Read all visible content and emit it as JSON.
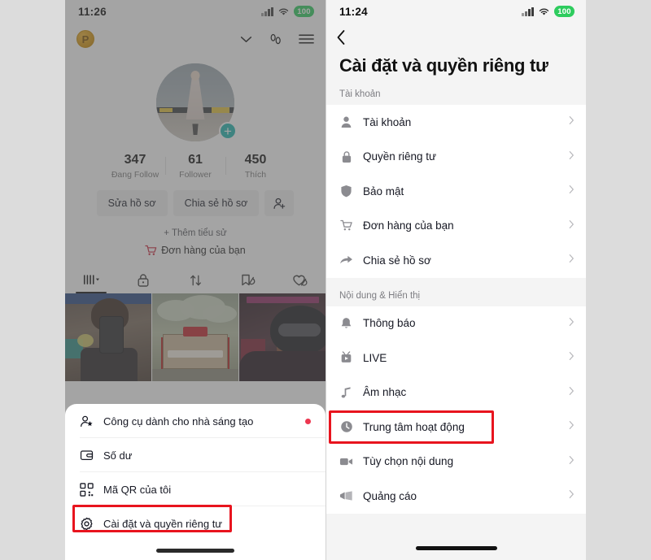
{
  "colors": {
    "highlight_red": "#E8141E",
    "accent_teal": "#1FB6B0",
    "battery_green": "#2ECC5E",
    "notification_dot_red": "#ED3750",
    "cart_red": "#c9243a",
    "page_background": "#dcdcdc",
    "card_background": "#ffffff",
    "group_background": "#f4f4f4"
  },
  "left_phone": {
    "status_bar": {
      "time": "11:26",
      "battery": "100",
      "signal_icon": "signal-bars-icon",
      "wifi_icon": "wifi-icon",
      "battery_icon": "battery-icon"
    },
    "header": {
      "coin_badge_label": "P",
      "coin_badge_icon": "coin-badge-icon",
      "chevron_icon": "chevron-down-icon",
      "footprints_icon": "visitor-footprints-icon",
      "menu_icon": "hamburger-menu-icon"
    },
    "profile": {
      "avatar_icon": "profile-avatar",
      "add_story_label": "+",
      "add_story_icon": "plus-badge-icon",
      "stats": [
        {
          "value": "347",
          "label": "Đang Follow"
        },
        {
          "value": "61",
          "label": "Follower"
        },
        {
          "value": "450",
          "label": "Thích"
        }
      ],
      "actions": [
        {
          "label": "Sửa hồ sơ",
          "name": "edit-profile-button"
        },
        {
          "label": "Chia sẻ hồ sơ",
          "name": "share-profile-button"
        }
      ],
      "add_friend_icon": "add-person-icon",
      "add_bio_label": "+ Thêm tiểu sử",
      "orders_label": "Đơn hàng của bạn",
      "orders_icon": "shopping-cart-icon"
    },
    "tabs": [
      {
        "name": "tab-posts",
        "icon": "grid-posts-icon",
        "active": true
      },
      {
        "name": "tab-private",
        "icon": "lock-icon",
        "active": false
      },
      {
        "name": "tab-reposts",
        "icon": "repost-arrows-icon",
        "active": false
      },
      {
        "name": "tab-saved",
        "icon": "bookmark-hidden-icon",
        "active": false
      },
      {
        "name": "tab-liked",
        "icon": "heart-hidden-icon",
        "active": false
      }
    ],
    "thumbnails": [
      {
        "name": "post-thumbnail-1"
      },
      {
        "name": "post-thumbnail-2"
      },
      {
        "name": "post-thumbnail-3"
      }
    ],
    "bottom_sheet": {
      "items": [
        {
          "label": "Công cụ dành cho nhà sáng tạo",
          "icon": "creator-tools-person-star-icon",
          "name": "sheet-item-creator-tools",
          "badge_dot": true
        },
        {
          "label": "Số dư",
          "icon": "wallet-icon",
          "name": "sheet-item-balance",
          "badge_dot": false
        },
        {
          "label": "Mã QR của tôi",
          "icon": "qr-code-icon",
          "name": "sheet-item-my-qr-code",
          "badge_dot": false
        },
        {
          "label": "Cài đặt và quyền riêng tư",
          "icon": "gear-icon",
          "name": "sheet-item-settings-privacy",
          "badge_dot": false,
          "highlighted": true
        }
      ]
    },
    "home_indicator_icon": "home-indicator"
  },
  "right_phone": {
    "status_bar": {
      "time": "11:24",
      "battery": "100",
      "signal_icon": "signal-bars-icon",
      "wifi_icon": "wifi-icon",
      "battery_icon": "battery-icon"
    },
    "back_icon": "back-chevron-icon",
    "title": "Cài đặt và quyền riêng tư",
    "sections": [
      {
        "label": "Tài khoản",
        "items": [
          {
            "label": "Tài khoản",
            "icon": "person-icon",
            "name": "settings-row-account",
            "highlighted": false
          },
          {
            "label": "Quyền riêng tư",
            "icon": "lock-icon",
            "name": "settings-row-privacy",
            "highlighted": false
          },
          {
            "label": "Bảo mật",
            "icon": "shield-icon",
            "name": "settings-row-security",
            "highlighted": false
          },
          {
            "label": "Đơn hàng của bạn",
            "icon": "shopping-cart-icon",
            "name": "settings-row-your-orders",
            "highlighted": false
          },
          {
            "label": "Chia sẻ hồ sơ",
            "icon": "share-arrow-icon",
            "name": "settings-row-share-profile",
            "highlighted": false
          }
        ]
      },
      {
        "label": "Nội dung & Hiển thị",
        "items": [
          {
            "label": "Thông báo",
            "icon": "bell-icon",
            "name": "settings-row-notifications",
            "highlighted": false
          },
          {
            "label": "LIVE",
            "icon": "live-broadcast-icon",
            "name": "settings-row-live",
            "highlighted": false
          },
          {
            "label": "Âm nhạc",
            "icon": "music-note-icon",
            "name": "settings-row-music",
            "highlighted": false
          },
          {
            "label": "Trung tâm hoạt động",
            "icon": "clock-icon",
            "name": "settings-row-activity-center",
            "highlighted": true
          },
          {
            "label": "Tùy chọn nội dung",
            "icon": "video-camera-icon",
            "name": "settings-row-content-preferences",
            "highlighted": false
          },
          {
            "label": "Quảng cáo",
            "icon": "megaphone-icon",
            "name": "settings-row-ads",
            "highlighted": false
          }
        ]
      }
    ],
    "chevron_icon": "chevron-right-icon",
    "home_indicator_icon": "home-indicator"
  }
}
